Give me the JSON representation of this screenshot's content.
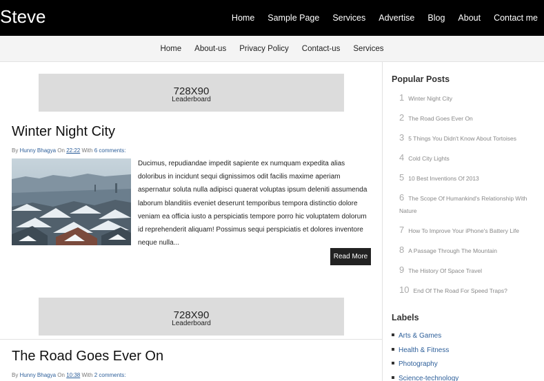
{
  "site": {
    "title": "Steve"
  },
  "top_nav": [
    "Home",
    "Sample Page",
    "Services",
    "Advertise",
    "Blog",
    "About",
    "Contact me"
  ],
  "sub_nav": [
    "Home",
    "About-us",
    "Privacy Policy",
    "Contact-us",
    "Services"
  ],
  "ads": [
    {
      "size": "728X90",
      "kind": "Leaderboard"
    },
    {
      "size": "728X90",
      "kind": "Leaderboard"
    }
  ],
  "posts": [
    {
      "title": "Winter Night City",
      "by": "By",
      "author": "Hunny Bhagya",
      "on": "On",
      "time": "22:22",
      "with": "With",
      "comments": "6 comments:",
      "excerpt": "Ducimus, repudiandae impedit sapiente ex numquam expedita alias doloribus in incidunt sequi dignissimos odit facilis maxime aperiam aspernatur soluta nulla adipisci quaerat voluptas ipsum deleniti assumenda laborum blanditiis eveniet deserunt temporibus tempora distinctio dolore veniam ea officia iusto a perspiciatis tempore porro hic voluptatem dolorum id reprehenderit aliquam! Possimus sequi perspiciatis et dolores inventore neque nulla...",
      "read_more": "Read More"
    },
    {
      "title": "The Road Goes Ever On",
      "by": "By",
      "author": "Hunny Bhagya",
      "on": "On",
      "time": "10:38",
      "with": "With",
      "comments": "2 comments:"
    }
  ],
  "sidebar": {
    "popular_heading": "Popular Posts",
    "popular": [
      {
        "num": "1",
        "title": "Winter Night City"
      },
      {
        "num": "2",
        "title": "The Road Goes Ever On"
      },
      {
        "num": "3",
        "title": "5 Things You Didn't Know About Tortoises"
      },
      {
        "num": "4",
        "title": "Cold City Lights"
      },
      {
        "num": "5",
        "title": "10 Best Inventions Of 2013"
      },
      {
        "num": "6",
        "title": "The Scope Of Humankind's Relationship With Nature"
      },
      {
        "num": "7",
        "title": "How To Improve Your iPhone's Battery Life"
      },
      {
        "num": "8",
        "title": "A Passage Through The Mountain"
      },
      {
        "num": "9",
        "title": "The History Of Space Travel"
      },
      {
        "num": "10",
        "title": "End Of The Road For Speed Traps?"
      }
    ],
    "labels_heading": "Labels",
    "labels": [
      "Arts & Games",
      "Health & Fitness",
      "Photography",
      "Science-technology"
    ]
  }
}
